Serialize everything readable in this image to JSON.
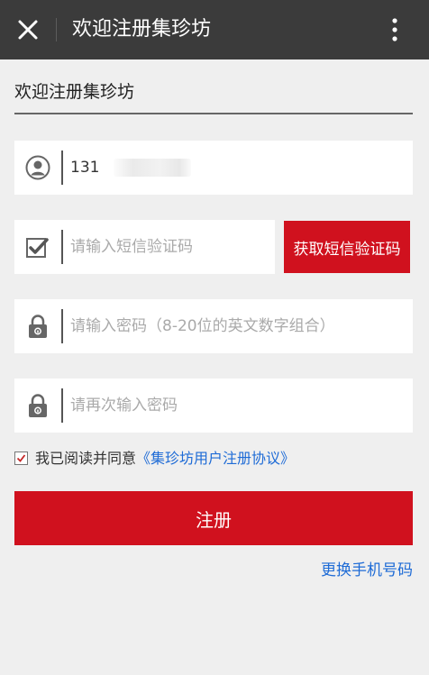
{
  "topbar": {
    "title": "欢迎注册集珍坊"
  },
  "heading": "欢迎注册集珍坊",
  "form": {
    "phone": {
      "value": "131",
      "icon": "user-icon"
    },
    "sms_code": {
      "placeholder": "请输入短信验证码",
      "icon": "verify-check-icon"
    },
    "password": {
      "placeholder": "请输入密码（8-20位的英文数字组合）",
      "icon": "lock-icon"
    },
    "confirm_password": {
      "placeholder": "请再次输入密码",
      "icon": "lock-icon"
    },
    "sms_button_label": "获取短信验证码"
  },
  "agreement": {
    "checked": true,
    "prefix": "我已阅读并同意",
    "link_text": "《集珍坊用户注册协议》"
  },
  "register_label": "注册",
  "change_phone_label": "更换手机号码",
  "colors": {
    "primary": "#d0111e",
    "link": "#1e6bd6",
    "topbar": "#3b3b3b",
    "background": "#efefef"
  }
}
